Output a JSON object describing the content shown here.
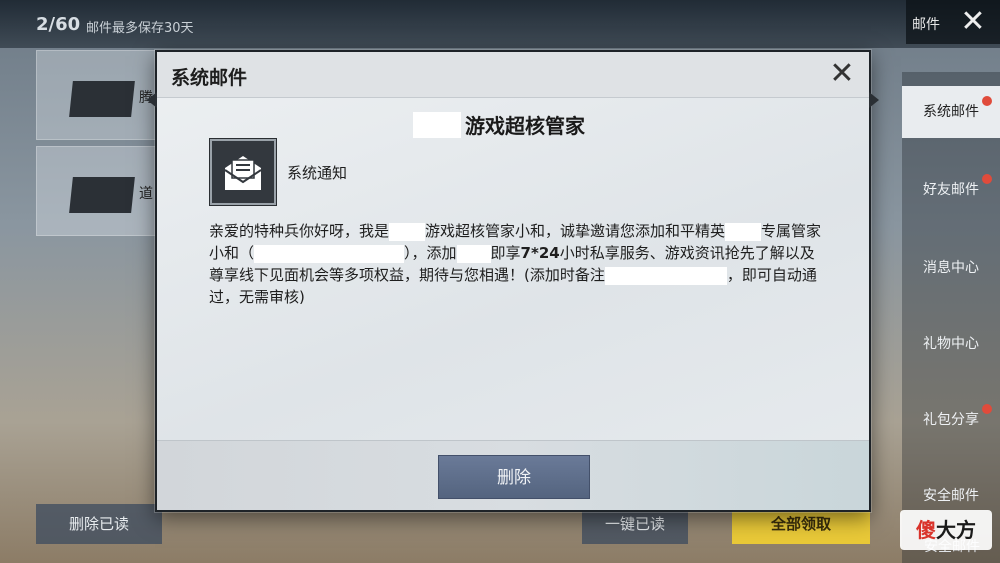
{
  "background": {
    "mail_count": "2/60",
    "mail_note": "邮件最多保存30天",
    "mail_title": "邮件",
    "close_glyph": "✕",
    "list_items": [
      {
        "label": "腾"
      },
      {
        "label": "道"
      }
    ],
    "sidebar": {
      "items": [
        {
          "label": "系统邮件",
          "active": true,
          "dot": true
        },
        {
          "label": "好友邮件",
          "active": false,
          "dot": true
        },
        {
          "label": "消息中心",
          "active": false,
          "dot": false
        },
        {
          "label": "礼物中心",
          "active": false,
          "dot": false
        },
        {
          "label": "礼包分享",
          "active": false,
          "dot": true
        },
        {
          "label": "安全邮件",
          "active": false,
          "dot": false
        }
      ]
    },
    "bottom": {
      "delete_read": "删除已读",
      "read_all": "一键已读",
      "collect_all": "全部领取",
      "safe_mail": "安全邮件"
    }
  },
  "dialog": {
    "title": "系统邮件",
    "close_glyph": "✕",
    "sender": "游戏超核管家",
    "notice_label": "系统通知",
    "body": {
      "p1": "亲爱的特种兵你好呀，我是",
      "p2": "游戏超核管家小和，诚挚邀请您添加和平精英",
      "p3": "专属管家小和（",
      "p4": "），添加",
      "p5": "即享",
      "p6_bold": "7*24",
      "p7": "小时私享服务、游戏资讯抢先了解以及尊享线下见面机会等多项权益，期待与您相遇！(添加时备注",
      "p8": "，即可自动通过，无需审核)"
    },
    "delete_label": "删除"
  },
  "watermark": {
    "first": "傻",
    "rest": "大方"
  },
  "colors": {
    "accent_button": "#5a6a86",
    "collect_yellow": "#e9c938",
    "badge_red": "#e04b3b"
  }
}
